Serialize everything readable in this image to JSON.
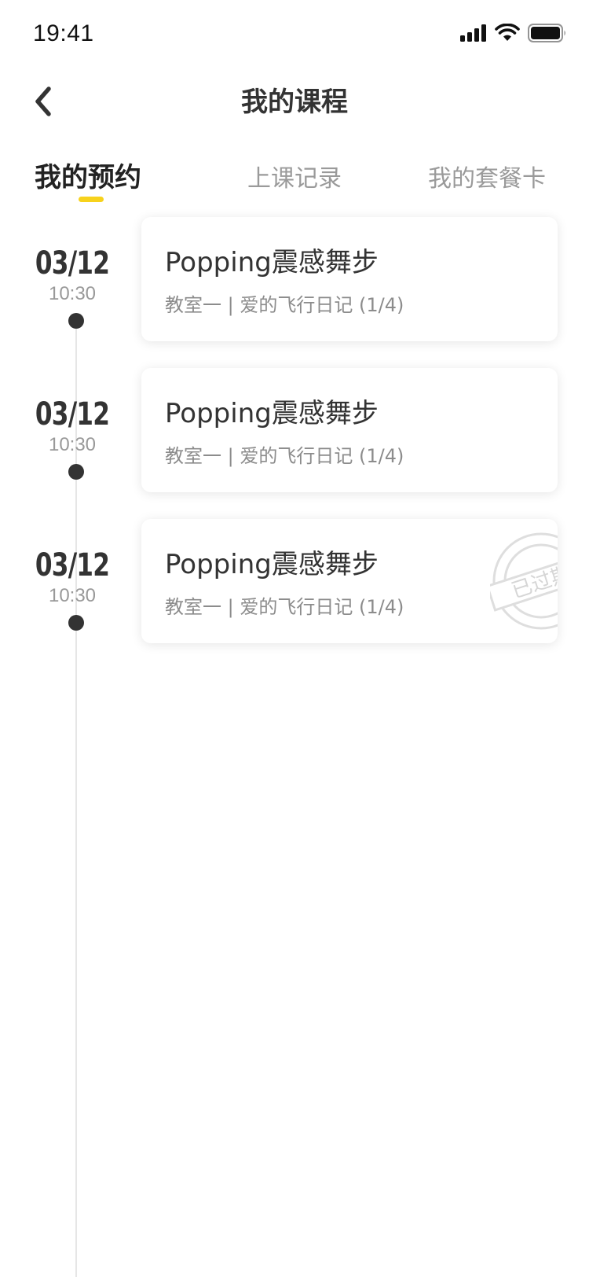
{
  "status_bar": {
    "time": "19:41"
  },
  "nav": {
    "title": "我的课程",
    "back_icon": "chevron-left-icon"
  },
  "tabs": [
    {
      "label": "我的预约",
      "active": true
    },
    {
      "label": "上课记录",
      "active": false
    },
    {
      "label": "我的套餐卡",
      "active": false
    }
  ],
  "colors": {
    "accent": "#f7d21c",
    "text_primary": "#333333",
    "text_secondary": "#8c8c8c",
    "timeline_dot": "#333333"
  },
  "bookings": [
    {
      "date": "03/12",
      "time": "10:30",
      "course": "Popping震感舞步",
      "detail": "教室一 | 爱的飞行日记 (1/4)",
      "expired": false
    },
    {
      "date": "03/12",
      "time": "10:30",
      "course": "Popping震感舞步",
      "detail": "教室一 | 爱的飞行日记 (1/4)",
      "expired": false
    },
    {
      "date": "03/12",
      "time": "10:30",
      "course": "Popping震感舞步",
      "detail": "教室一 | 爱的飞行日记 (1/4)",
      "expired": true,
      "stamp_text": "已过期"
    }
  ]
}
